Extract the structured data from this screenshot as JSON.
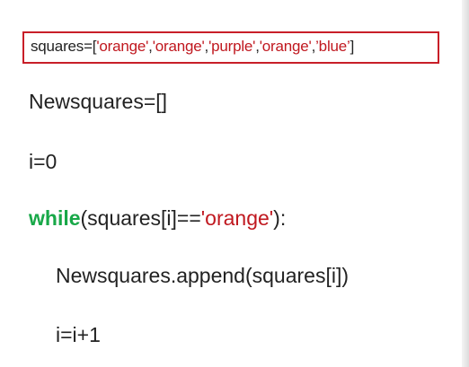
{
  "code": {
    "line1": {
      "prefix": "squares=[",
      "items": [
        "'orange'",
        "'orange'",
        "'purple'",
        "'orange'",
        "’blue’"
      ],
      "separator": ",",
      "suffix": "]"
    },
    "line2": "Newsquares=[]",
    "line3": "i=0",
    "line4": {
      "keyword": "while",
      "middle": "(squares[i]==",
      "string": "'orange'",
      "end": "):"
    },
    "line5": "Newsquares.append(squares[i])",
    "line6": "i=i+1"
  },
  "colors": {
    "highlight_border": "#c81e28",
    "string": "#c0181f",
    "keyword": "#18a848",
    "text": "#222222"
  }
}
